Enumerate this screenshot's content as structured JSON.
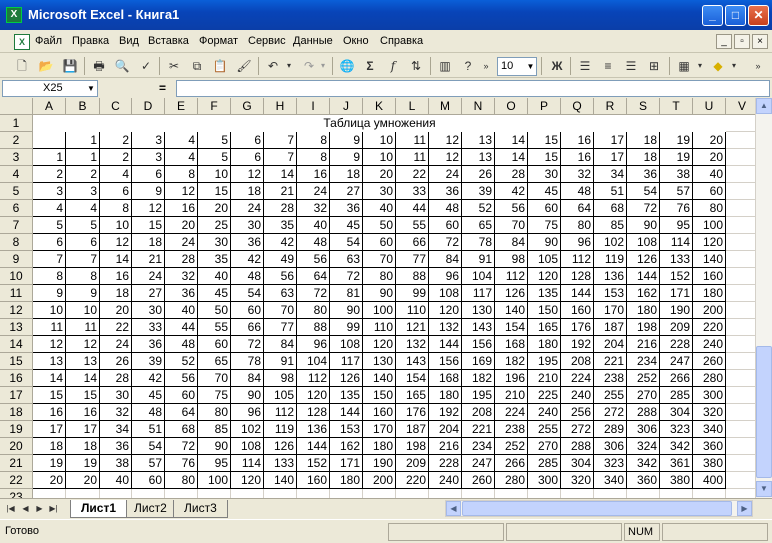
{
  "window": {
    "title": "Microsoft Excel - Книга1",
    "app_icon": "excel-icon",
    "minimize": "_",
    "maximize": "□",
    "close": "✕"
  },
  "menu": {
    "items": [
      "Файл",
      "Правка",
      "Вид",
      "Вставка",
      "Формат",
      "Сервис",
      "Данные",
      "Окно",
      "Справка"
    ],
    "doc_buttons": [
      "_",
      "▫",
      "×"
    ]
  },
  "toolbar": {
    "zoom": "10",
    "bold_label": "Ж",
    "sum_label": "Σ",
    "fx_label": "f"
  },
  "formula_bar": {
    "cell_ref": "X25",
    "fx": "=",
    "content": ""
  },
  "columns": [
    "A",
    "B",
    "C",
    "D",
    "E",
    "F",
    "G",
    "H",
    "I",
    "J",
    "K",
    "L",
    "M",
    "N",
    "O",
    "P",
    "Q",
    "R",
    "S",
    "T",
    "U",
    "V"
  ],
  "rows": [
    "1",
    "2",
    "3",
    "4",
    "5",
    "6",
    "7",
    "8",
    "9",
    "10",
    "11",
    "12",
    "13",
    "14",
    "15",
    "16",
    "17",
    "18",
    "19",
    "20",
    "21",
    "22",
    "23"
  ],
  "table": {
    "title": "Таблица умножения",
    "header_row": [
      1,
      2,
      3,
      4,
      5,
      6,
      7,
      8,
      9,
      10,
      11,
      12,
      13,
      14,
      15,
      16,
      17,
      18,
      19,
      20
    ],
    "multipliers": [
      1,
      2,
      3,
      4,
      5,
      6,
      7,
      8,
      9,
      10,
      11,
      12,
      13,
      14,
      15,
      16,
      17,
      18,
      19,
      20
    ],
    "products": [
      [
        1,
        2,
        3,
        4,
        5,
        6,
        7,
        8,
        9,
        10,
        11,
        12,
        13,
        14,
        15,
        16,
        17,
        18,
        19,
        20
      ],
      [
        2,
        4,
        6,
        8,
        10,
        12,
        14,
        16,
        18,
        20,
        22,
        24,
        26,
        28,
        30,
        32,
        34,
        36,
        38,
        40
      ],
      [
        3,
        6,
        9,
        12,
        15,
        18,
        21,
        24,
        27,
        30,
        33,
        36,
        39,
        42,
        45,
        48,
        51,
        54,
        57,
        60
      ],
      [
        4,
        8,
        12,
        16,
        20,
        24,
        28,
        32,
        36,
        40,
        44,
        48,
        52,
        56,
        60,
        64,
        68,
        72,
        76,
        80
      ],
      [
        5,
        10,
        15,
        20,
        25,
        30,
        35,
        40,
        45,
        50,
        55,
        60,
        65,
        70,
        75,
        80,
        85,
        90,
        95,
        100
      ],
      [
        6,
        12,
        18,
        24,
        30,
        36,
        42,
        48,
        54,
        60,
        66,
        72,
        78,
        84,
        90,
        96,
        102,
        108,
        114,
        120
      ],
      [
        7,
        14,
        21,
        28,
        35,
        42,
        49,
        56,
        63,
        70,
        77,
        84,
        91,
        98,
        105,
        112,
        119,
        126,
        133,
        140
      ],
      [
        8,
        16,
        24,
        32,
        40,
        48,
        56,
        64,
        72,
        80,
        88,
        96,
        104,
        112,
        120,
        128,
        136,
        144,
        152,
        160
      ],
      [
        9,
        18,
        27,
        36,
        45,
        54,
        63,
        72,
        81,
        90,
        99,
        108,
        117,
        126,
        135,
        144,
        153,
        162,
        171,
        180
      ],
      [
        10,
        20,
        30,
        40,
        50,
        60,
        70,
        80,
        90,
        100,
        110,
        120,
        130,
        140,
        150,
        160,
        170,
        180,
        190,
        200
      ],
      [
        11,
        22,
        33,
        44,
        55,
        66,
        77,
        88,
        99,
        110,
        121,
        132,
        143,
        154,
        165,
        176,
        187,
        198,
        209,
        220
      ],
      [
        12,
        24,
        36,
        48,
        60,
        72,
        84,
        96,
        108,
        120,
        132,
        144,
        156,
        168,
        180,
        192,
        204,
        216,
        228,
        240
      ],
      [
        13,
        26,
        39,
        52,
        65,
        78,
        91,
        104,
        117,
        130,
        143,
        156,
        169,
        182,
        195,
        208,
        221,
        234,
        247,
        260
      ],
      [
        14,
        28,
        42,
        56,
        70,
        84,
        98,
        112,
        126,
        140,
        154,
        168,
        182,
        196,
        210,
        224,
        238,
        252,
        266,
        280
      ],
      [
        15,
        30,
        45,
        60,
        75,
        90,
        105,
        120,
        135,
        150,
        165,
        180,
        195,
        210,
        225,
        240,
        255,
        270,
        285,
        300
      ],
      [
        16,
        32,
        48,
        64,
        80,
        96,
        112,
        128,
        144,
        160,
        176,
        192,
        208,
        224,
        240,
        256,
        272,
        288,
        304,
        320
      ],
      [
        17,
        34,
        51,
        68,
        85,
        102,
        119,
        136,
        153,
        170,
        187,
        204,
        221,
        238,
        255,
        272,
        289,
        306,
        323,
        340
      ],
      [
        18,
        36,
        54,
        72,
        90,
        108,
        126,
        144,
        162,
        180,
        198,
        216,
        234,
        252,
        270,
        288,
        306,
        324,
        342,
        360
      ],
      [
        19,
        38,
        57,
        76,
        95,
        114,
        133,
        152,
        171,
        190,
        209,
        228,
        247,
        266,
        285,
        304,
        323,
        342,
        361,
        380
      ],
      [
        20,
        40,
        60,
        80,
        100,
        120,
        140,
        160,
        180,
        200,
        220,
        240,
        260,
        280,
        300,
        320,
        340,
        360,
        380,
        400
      ]
    ]
  },
  "sheets": [
    "Лист1",
    "Лист2",
    "Лист3"
  ],
  "active_sheet": "Лист1",
  "status": {
    "text": "Готово",
    "num": "NUM"
  }
}
